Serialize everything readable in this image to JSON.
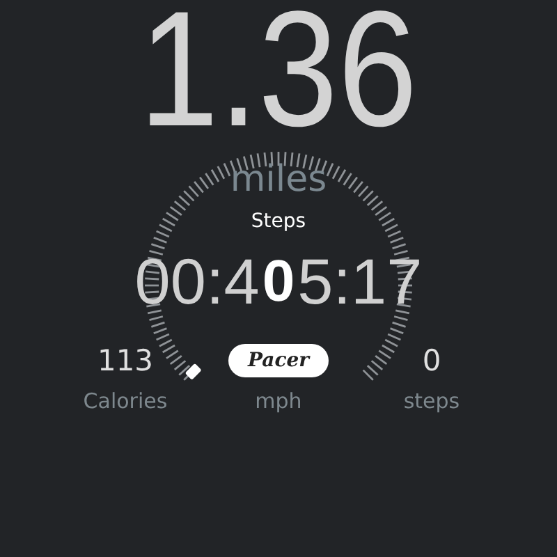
{
  "distance": {
    "value": "1.36",
    "unit": "miles"
  },
  "steps_label": "Steps",
  "timer": {
    "left": "00:4",
    "overlay": "0",
    "right": "5:17"
  },
  "stats": [
    {
      "kind": "value",
      "value": "113",
      "label": "Calories"
    },
    {
      "kind": "badge",
      "badge": "Pacer",
      "label": "mph"
    },
    {
      "kind": "value",
      "value": "0",
      "label": "steps"
    }
  ]
}
